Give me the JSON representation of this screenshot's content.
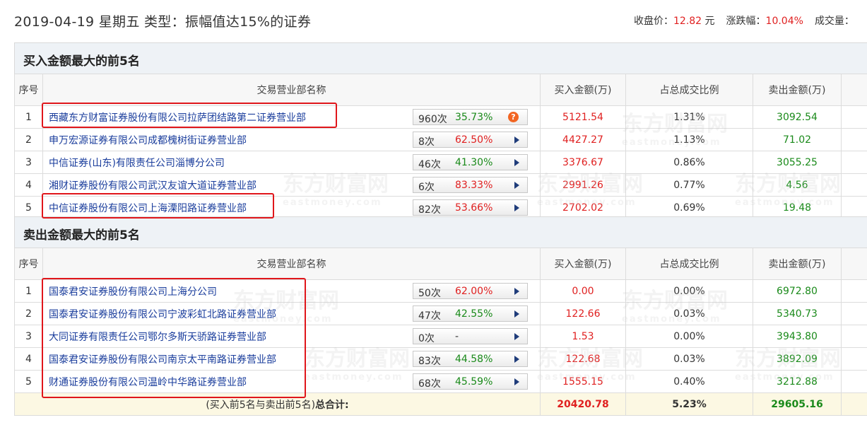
{
  "header": {
    "title": "2019-04-19 星期五 类型：振幅值达15%的证券",
    "close_label": "收盘价：",
    "close_value": "12.82",
    "close_unit": "元",
    "change_label": "涨跌幅：",
    "change_value": "10.04%",
    "volume_label": "成交量："
  },
  "buy": {
    "title": "买入金额最大的前5名",
    "columns": [
      "序号",
      "交易营业部名称",
      "买入金额(万)",
      "占总成交比例",
      "卖出金额(万)"
    ],
    "rows": [
      {
        "idx": "1",
        "name": "西藏东方财富证券股份有限公司拉萨团结路第二证券营业部",
        "count": "960次",
        "pct": "35.73%",
        "pct_color": "green",
        "icon": "question-icon",
        "buy": "5121.54",
        "ratio": "1.31%",
        "sell": "3092.54"
      },
      {
        "idx": "2",
        "name": "申万宏源证券有限公司成都槐树街证券营业部",
        "count": "8次",
        "pct": "62.50%",
        "pct_color": "red",
        "icon": "arrow-right-icon",
        "buy": "4427.27",
        "ratio": "1.13%",
        "sell": "71.02"
      },
      {
        "idx": "3",
        "name": "中信证券(山东)有限责任公司淄博分公司",
        "count": "46次",
        "pct": "41.30%",
        "pct_color": "green",
        "icon": "arrow-right-icon",
        "buy": "3376.67",
        "ratio": "0.86%",
        "sell": "3055.25"
      },
      {
        "idx": "4",
        "name": "湘财证券股份有限公司武汉友谊大道证券营业部",
        "count": "6次",
        "pct": "83.33%",
        "pct_color": "red",
        "icon": "arrow-right-icon",
        "buy": "2991.26",
        "ratio": "0.77%",
        "sell": "4.56"
      },
      {
        "idx": "5",
        "name": "中信证券股份有限公司上海溧阳路证券营业部",
        "count": "82次",
        "pct": "53.66%",
        "pct_color": "red",
        "icon": "arrow-right-icon",
        "buy": "2702.02",
        "ratio": "0.69%",
        "sell": "19.48"
      }
    ]
  },
  "sell": {
    "title": "卖出金额最大的前5名",
    "columns": [
      "序号",
      "交易营业部名称",
      "买入金额(万)",
      "占总成交比例",
      "卖出金额(万)"
    ],
    "rows": [
      {
        "idx": "1",
        "name": "国泰君安证券股份有限公司上海分公司",
        "count": "50次",
        "pct": "62.00%",
        "pct_color": "red",
        "icon": "arrow-right-icon",
        "buy": "0.00",
        "ratio": "0.00%",
        "sell": "6972.80"
      },
      {
        "idx": "2",
        "name": "国泰君安证券股份有限公司宁波彩虹北路证券营业部",
        "count": "47次",
        "pct": "42.55%",
        "pct_color": "green",
        "icon": "arrow-right-icon",
        "buy": "122.66",
        "ratio": "0.03%",
        "sell": "5340.73"
      },
      {
        "idx": "3",
        "name": "大同证券有限责任公司鄂尔多斯天骄路证券营业部",
        "count": "0次",
        "pct": "-",
        "pct_color": "gray",
        "icon": "arrow-right-icon",
        "buy": "1.53",
        "ratio": "0.00%",
        "sell": "3943.80"
      },
      {
        "idx": "4",
        "name": "国泰君安证券股份有限公司南京太平南路证券营业部",
        "count": "83次",
        "pct": "44.58%",
        "pct_color": "green",
        "icon": "arrow-right-icon",
        "buy": "122.68",
        "ratio": "0.03%",
        "sell": "3892.09"
      },
      {
        "idx": "5",
        "name": "财通证券股份有限公司温岭中华路证券营业部",
        "count": "68次",
        "pct": "45.59%",
        "pct_color": "green",
        "icon": "arrow-right-icon",
        "buy": "1555.15",
        "ratio": "0.40%",
        "sell": "3212.88"
      }
    ]
  },
  "total": {
    "label_prefix": "(买入前5名与卖出前5名)",
    "label_bold": "总合计:",
    "buy": "20420.78",
    "ratio": "5.23%",
    "sell": "29605.16"
  },
  "watermark": {
    "cn": "东方财富网",
    "en": "eastmoney.com"
  },
  "colors": {
    "red": "#e02020",
    "green": "#1a8a1a",
    "link": "#1a3d9c",
    "highlight": "#e0161b",
    "header_bg": "#eef2f6",
    "total_bg": "#fcf8e3"
  }
}
